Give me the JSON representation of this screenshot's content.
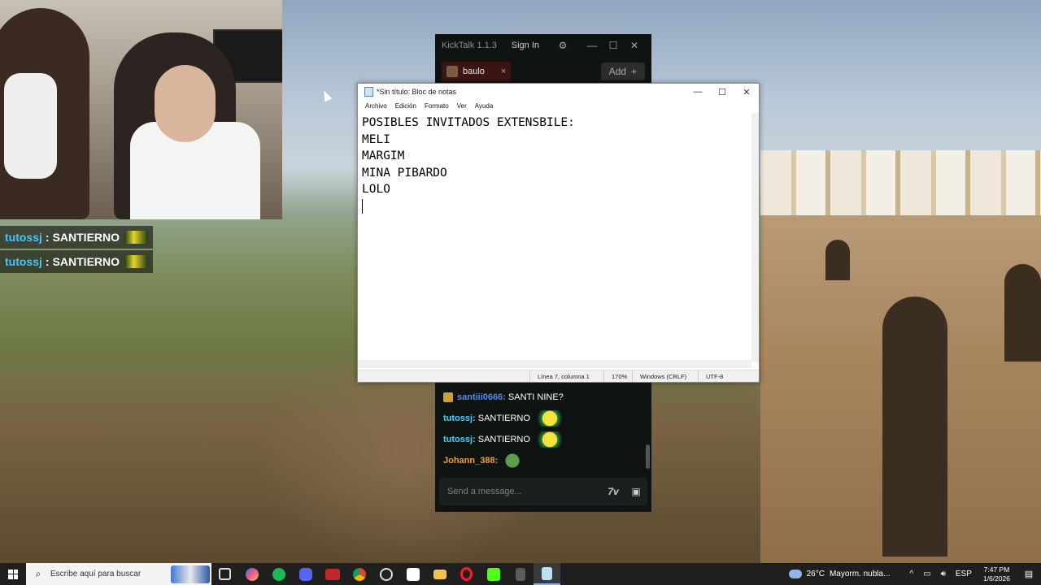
{
  "stream_overlay": {
    "messages": [
      {
        "user": "tutossj",
        "sep": ":",
        "text": "SANTIERNO"
      },
      {
        "user": "tutossj",
        "sep": ":",
        "text": "SANTIERNO"
      }
    ]
  },
  "kicktalk": {
    "title": "KickTalk 1.1.3",
    "sign_in": "Sign In",
    "settings_icon": "gear-icon",
    "minimize": "—",
    "maximize": "☐",
    "close": "✕",
    "tab": {
      "label": "baulo",
      "close": "×"
    },
    "add_label": "Add",
    "add_icon": "+",
    "chat": [
      {
        "user": "santiii0666:",
        "text": "SANTI NINE?",
        "color": "#4f8bf0",
        "badge": true
      },
      {
        "user": "tutossj:",
        "text": "SANTIERNO",
        "color": "#37d4ff",
        "emote": "emote"
      },
      {
        "user": "tutossj:",
        "text": "SANTIERNO",
        "color": "#37d4ff",
        "emote": "emote"
      },
      {
        "user": "Johann_388:",
        "text": "",
        "color": "#f0a020",
        "emote": "frog"
      }
    ],
    "input_placeholder": "Send a message...",
    "emote_button_icon": "7TV",
    "kick_emote_icon": "emote-icon"
  },
  "notepad": {
    "title": "*Sin título: Bloc de notas",
    "window_controls": {
      "minimize": "—",
      "maximize": "☐",
      "close": "✕"
    },
    "menu": [
      "Archivo",
      "Edición",
      "Formato",
      "Ver",
      "Ayuda"
    ],
    "lines": [
      "POSIBLES INVITADOS EXTENSBILE:",
      "",
      "MELI",
      "MARGIM",
      "MINA PIBARDO",
      "LOLO"
    ],
    "status": {
      "position": "Línea 7, columna 1",
      "zoom": "170%",
      "line_endings": "Windows (CRLF)",
      "encoding": "UTF-8"
    }
  },
  "taskbar": {
    "search_placeholder": "Escribe aquí para buscar",
    "weather": {
      "temp": "26°C",
      "condition": "Mayorm. nubla..."
    },
    "tray": {
      "chevron": "^",
      "language": "ESP"
    },
    "clock": {
      "time": "7:47 PM",
      "date": "1/6/2026"
    }
  }
}
